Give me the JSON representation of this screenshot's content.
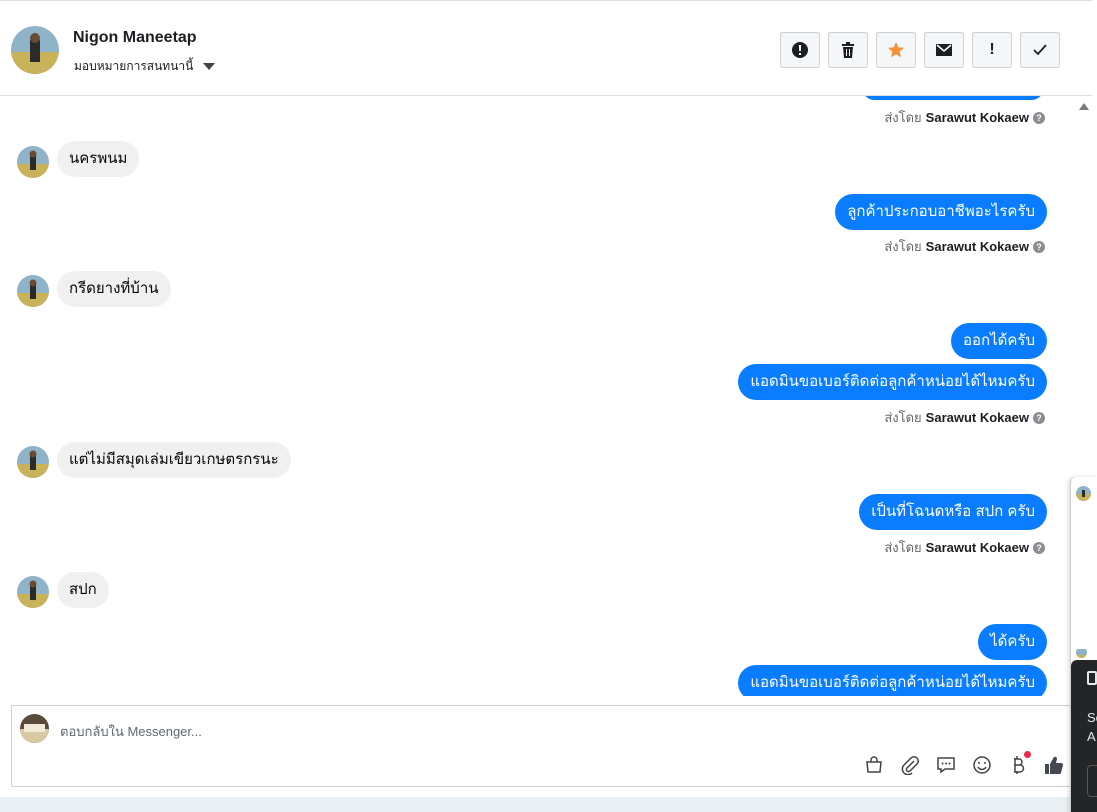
{
  "header": {
    "contact_name": "Nigon Maneetap",
    "assign_label": "มอบหมายการสนทนานี้",
    "actions": [
      {
        "name": "mark-spam-button",
        "glyph": "!",
        "icon": "alert-circle-icon"
      },
      {
        "name": "delete-button",
        "glyph": "",
        "icon": "trash-icon"
      },
      {
        "name": "star-button",
        "glyph": "",
        "icon": "star-icon"
      },
      {
        "name": "mark-unread-button",
        "glyph": "",
        "icon": "envelope-icon"
      },
      {
        "name": "follow-up-button",
        "glyph": "!",
        "icon": "exclamation-icon"
      },
      {
        "name": "mark-done-button",
        "glyph": "",
        "icon": "checkmark-icon"
      }
    ]
  },
  "messages": {
    "sent_by_prefix": "ส่งโดย",
    "agent_name": "Sarawut Kokaew",
    "m1": "นครพนม",
    "m2": "ลูกค้าประกอบอาชีพอะไรครับ",
    "m3": "กรีดยางที่บ้าน",
    "m4": "ออกได้ครับ",
    "m5": "แอดมินขอเบอร์ติดต่อลูกค้าหน่อยได้ไหมครับ",
    "m6": "แต่ไม่มีสมุดเล่มเขียวเกษตรกรนะ",
    "m7": "เป็นที่โฉนดหรือ สปก ครับ",
    "m8": "สปก",
    "m9": "ได้ครับ",
    "m10": "แอดมินขอเบอร์ติดต่อลูกค้าหน่อยได้ไหมครับ"
  },
  "composer": {
    "placeholder": "ตอบกลับใน Messenger..."
  },
  "side_panel": {
    "line1": "Se",
    "line2": "A"
  },
  "colors": {
    "outgoing": "#0a7cff",
    "incoming": "#f0f0f0",
    "star": "#f7923b",
    "like": "#444950"
  }
}
